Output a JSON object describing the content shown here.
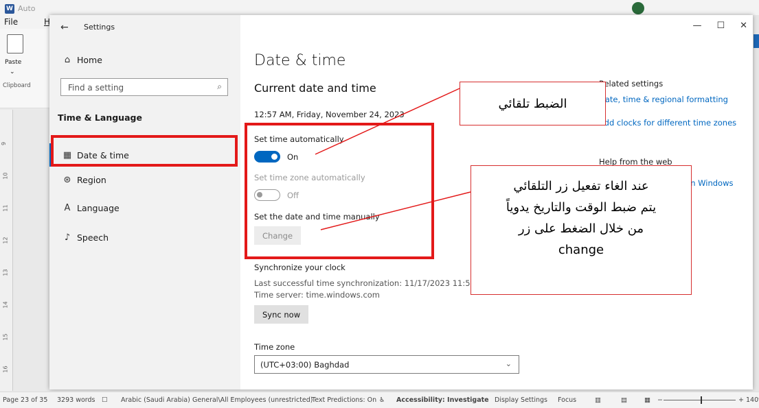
{
  "word": {
    "app_title": "Auto",
    "menu_file": "File",
    "menu_home": "H",
    "paste_label": "Paste",
    "clipboard_label": "Clipboard",
    "ruler_numbers": [
      "9",
      "10",
      "11",
      "12",
      "13",
      "14",
      "15",
      "16"
    ],
    "status": {
      "page": "Page 23 of 35",
      "words": "3293 words",
      "language": "Arabic (Saudi Arabia)",
      "sensitivity": "General\\All Employees (unrestricted)",
      "predictions": "Text Predictions: On",
      "accessibility": "Accessibility: Investigate",
      "display": "Display Settings",
      "focus": "Focus",
      "zoom": "140%"
    }
  },
  "settings": {
    "window_title": "Settings",
    "nav_home": "Home",
    "search_placeholder": "Find a setting",
    "section_heading": "Time & Language",
    "nav_items": [
      {
        "label": "Date & time",
        "icon": "calendar-clock-icon"
      },
      {
        "label": "Region",
        "icon": "globe-icon"
      },
      {
        "label": "Language",
        "icon": "language-icon"
      },
      {
        "label": "Speech",
        "icon": "microphone-icon"
      }
    ],
    "page_title": "Date & time",
    "current_heading": "Current date and time",
    "current_time": "12:57 AM, Friday, November 24, 2023",
    "set_time_auto_label": "Set time automatically",
    "set_time_auto_state": "On",
    "set_tz_auto_label": "Set time zone automatically",
    "set_tz_auto_state": "Off",
    "manual_label": "Set the date and time manually",
    "change_button": "Change",
    "sync_heading": "Synchronize your clock",
    "sync_last": "Last successful time synchronization: 11/17/2023 11:50:25 PM",
    "sync_server": "Time server: time.windows.com",
    "sync_button": "Sync now",
    "tz_label": "Time zone",
    "tz_value": "(UTC+03:00) Baghdad",
    "related_heading": "Related settings",
    "related_link_1": "Date, time & regional formatting",
    "related_link_2": "Add clocks for different time zones",
    "help_heading": "Help from the web",
    "help_link": "in Windows"
  },
  "annotations": {
    "callout_1": "الضبط تلقائي",
    "callout_2_line_1": "عند الغاء تفعيل زر التلقائي",
    "callout_2_line_2": "يتم ضبط الوقت والتاريخ يدوياً",
    "callout_2_line_3": "من خلال الضغط على زر",
    "callout_2_line_4": "change"
  },
  "colors": {
    "accent": "#0067c0",
    "annotation_red": "#e31919",
    "word_blue": "#2b579a"
  }
}
